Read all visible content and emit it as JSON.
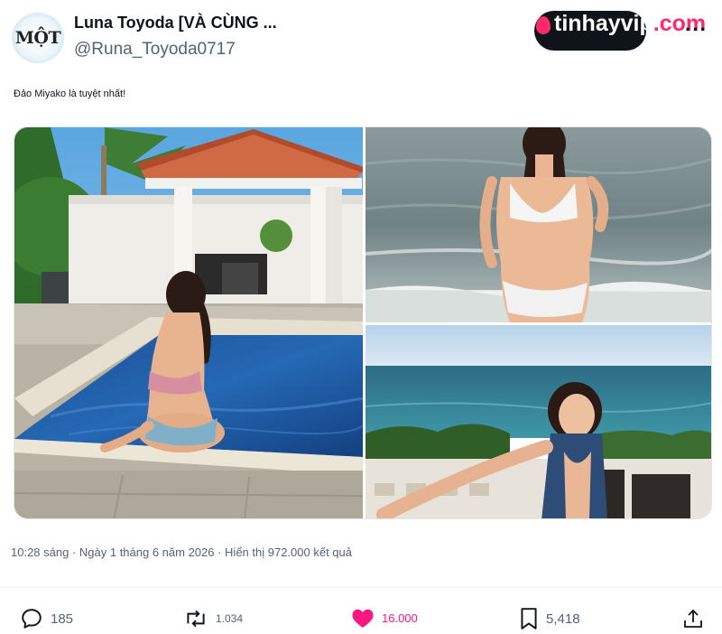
{
  "author": {
    "avatar_text": "MỘT",
    "display_name": "Luna Toyoda [VÀ CÙNG ...",
    "handle": "@Runa_Toyoda0717"
  },
  "watermark": {
    "part1": "tinhay",
    "part2": "vip",
    "part3": ".com"
  },
  "more_menu": "···",
  "tweet": {
    "text": "Đảo Miyako là tuyệt nhất!",
    "meta": "10:28 sáng · Ngày 1 tháng 6 năm 2026 · Hiển thị 972.000 kết quả"
  },
  "media": [
    {
      "description": "poolside-photo"
    },
    {
      "description": "beach-photo"
    },
    {
      "description": "ocean-terrace-photo"
    }
  ],
  "actions": {
    "replies": "185",
    "retweets": "1.034",
    "likes": "16.000",
    "bookmarks": "5,418"
  },
  "colors": {
    "like_active": "#f91880",
    "secondary_text": "#536471",
    "watermark_pink": "#ff2a6a"
  }
}
